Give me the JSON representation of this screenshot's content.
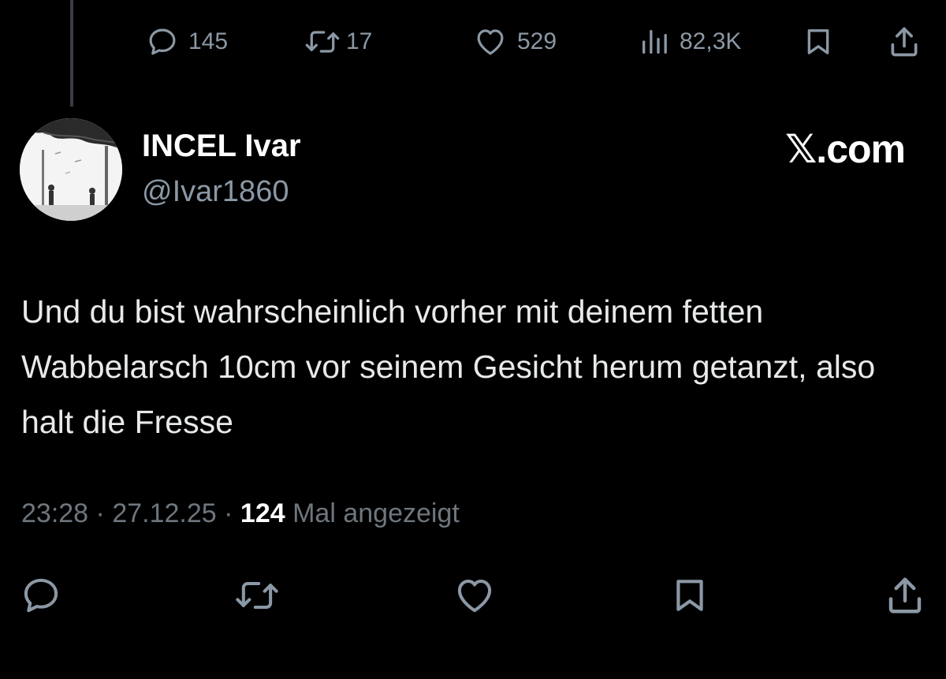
{
  "previous_tweet": {
    "stats": {
      "replies": "145",
      "reposts": "17",
      "likes": "529",
      "views": "82,3K"
    },
    "icons": [
      "reply-icon",
      "repost-icon",
      "like-icon",
      "views-icon",
      "bookmark-icon",
      "share-icon"
    ]
  },
  "tweet": {
    "author": {
      "display_name": "INCEL Ivar",
      "handle": "@Ivar1860"
    },
    "brand": "𝕏.com",
    "text": "Und du bist wahrscheinlich vorher mit deinem fetten Wabbelarsch 10cm vor seinem Gesicht herum getanzt, also halt die Fresse",
    "time": "23:28",
    "date": "27.12.25",
    "views_count": "124",
    "views_label": "Mal angezeigt",
    "separator": "·"
  },
  "actions": {
    "icons": [
      "reply-icon",
      "repost-icon",
      "like-icon",
      "bookmark-icon",
      "share-icon"
    ]
  },
  "colors": {
    "background": "#000000",
    "text": "#e7e9ea",
    "secondary": "#8b98a5",
    "meta": "#6e767d",
    "thread_line": "#3a3d41"
  }
}
